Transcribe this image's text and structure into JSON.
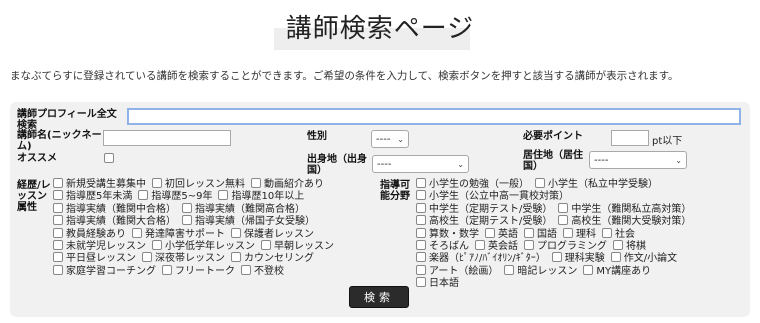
{
  "header": {
    "title": "講師検索ページ",
    "intro": "まなぶてらすに登録されている講師を検索することができます。ご希望の条件を入力して、検索ボタンを押すと該当する講師が表示されます。"
  },
  "form": {
    "profile_fulltext_label": "講師プロフィール全文検索",
    "profile_fulltext_value": "",
    "name_label": "講師名(ニックネーム)",
    "name_value": "",
    "gender_label": "性別",
    "gender_value": "----",
    "points_label": "必要ポイント",
    "points_value": "",
    "points_unit": "pt以下",
    "recommend_label": "オススメ",
    "origin_label": "出身地（出身国）",
    "origin_value": "----",
    "residence_label": "居住地（居住国）",
    "residence_value": "----",
    "career_label": "経歴/レッスン属性",
    "career_rows": [
      [
        "新規受講生募集中",
        "初回レッスン無料",
        "動画紹介あり"
      ],
      [
        "指導歴5年未満",
        "指導歴5~9年",
        "指導歴10年以上"
      ],
      [
        "指導実績（難関中合格）",
        "指導実績（難関高合格）"
      ],
      [
        "指導実績（難関大合格）",
        "指導実績（帰国子女受験）"
      ],
      [
        "教員経験あり",
        "発達障害サポート",
        "保護者レッスン"
      ],
      [
        "未就学児レッスン",
        "小学低学年レッスン",
        "早朝レッスン"
      ],
      [
        "平日昼レッスン",
        "深夜帯レッスン",
        "カウンセリング"
      ],
      [
        "家庭学習コーチング",
        "フリートーク",
        "不登校"
      ]
    ],
    "fields_label": "指導可能分野",
    "fields_rows": [
      [
        "小学生の勉強（一般）",
        "小学生（私立中学受験）"
      ],
      [
        "小学生（公立中高一貫校対策）"
      ],
      [
        "中学生（定期テスト/受験）",
        "中学生（難関私立高対策）"
      ],
      [
        "高校生（定期テスト/受験）",
        "高校生（難関大受験対策）"
      ],
      [
        "算数・数学",
        "英語",
        "国語",
        "理科",
        "社会"
      ],
      [
        "そろばん",
        "英会話",
        "プログラミング",
        "将棋"
      ],
      [
        "楽器（ﾋﾟｱﾉ/ﾊﾞｲｵﾘﾝ/ｷﾞﾀｰ）",
        "理科実験",
        "作文/小論文"
      ],
      [
        "アート（絵画）",
        "暗記レッスン",
        "MY講座あり"
      ],
      [
        "日本語"
      ]
    ],
    "search_button": "検索"
  }
}
